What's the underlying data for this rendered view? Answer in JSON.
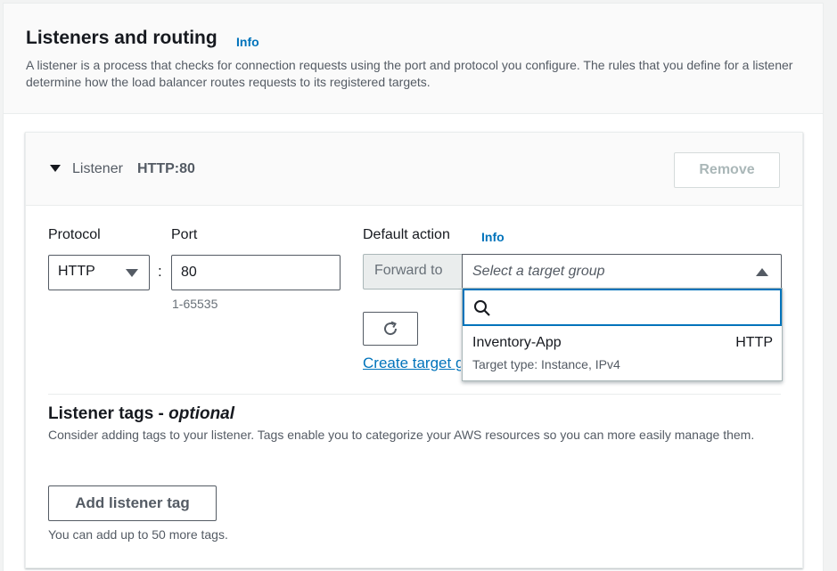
{
  "section": {
    "title": "Listeners and routing",
    "info": "Info",
    "description": "A listener is a process that checks for connection requests using the port and protocol you configure. The rules that you define for a listener determine how the load balancer routes requests to its registered targets."
  },
  "listener": {
    "label": "Listener",
    "name": "HTTP:80",
    "remove_label": "Remove",
    "protocol_label": "Protocol",
    "protocol_value": "HTTP",
    "port_label": "Port",
    "port_value": "80",
    "port_hint": "1-65535",
    "default_action_label": "Default action",
    "default_action_info": "Info",
    "forward_to": "Forward to",
    "target_group_placeholder": "Select a target group",
    "create_target_link": "Create target group"
  },
  "dropdown": {
    "search_value": "",
    "options": [
      {
        "name": "Inventory-App",
        "protocol": "HTTP",
        "description": "Target type: Instance, IPv4"
      }
    ]
  },
  "tags": {
    "title": "Listener tags - ",
    "title_optional": "optional",
    "description": "Consider adding tags to your listener. Tags enable you to categorize your AWS resources so you can more easily manage them.",
    "add_button": "Add listener tag",
    "hint": "You can add up to 50 more tags."
  }
}
